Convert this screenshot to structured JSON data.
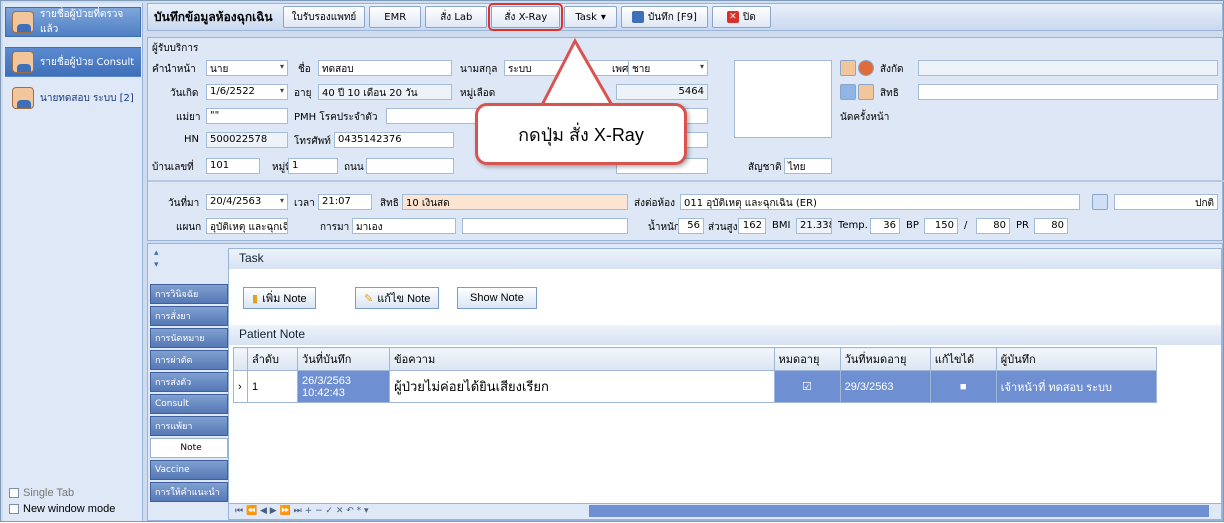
{
  "leftnav": {
    "items": [
      {
        "label": "รายชื่อผู้ป่วยที่ตรวจแล้ว"
      },
      {
        "label": "รายชื่อผู้ป่วย Consult"
      },
      {
        "label": "นายทดสอบ ระบบ [2]"
      }
    ],
    "single_tab": "Single Tab",
    "new_window": "New window mode"
  },
  "toolbar": {
    "title": "บันทึกข้อมูลห้องฉุกเฉิน",
    "btn_cert": "ใบรับรองแพทย์",
    "btn_emr": "EMR",
    "btn_lab": "สั่ง Lab",
    "btn_xray": "สั่ง X-Ray",
    "btn_task": "Task",
    "btn_save": "บันทึก [F9]",
    "btn_close": "ปิด"
  },
  "callout": {
    "text": "กดปุ่ม สั่ง X-Ray"
  },
  "form": {
    "section": "ผู้รับบริการ",
    "prefix_lbl": "คำนำหน้า",
    "prefix": "นาย",
    "name_lbl": "ชื่อ",
    "name": "ทดสอบ",
    "surname_lbl": "นามสกุล",
    "surname": "ระบบ",
    "sex_lbl": "เพศ",
    "sex": "ชาย",
    "affil_lbl": "สังกัด",
    "dob_lbl": "วันเกิด",
    "dob": "1/6/2522",
    "age_lbl": "อายุ",
    "age": "40 ปี 10 เดือน 20 วัน",
    "blood_lbl": "หมู่เลือด",
    "cid": "5464",
    "right_lbl": "สิทธิ",
    "mother_lbl": "แม่ยา",
    "mother": "\"\"",
    "pmh_lbl": "PMH โรคประจำตัว",
    "appt_lbl": "นัดครั้งหน้า",
    "hn_lbl": "HN",
    "hn": "500022578",
    "phone_lbl": "โทรศัพท์",
    "phone": "0435142376",
    "house_lbl": "บ้านเลขที่",
    "house": "101",
    "moo_lbl": "หมู่ที่",
    "moo": "1",
    "road_lbl": "ถนน",
    "nation_lbl": "สัญชาติ",
    "nation": "ไทย",
    "visit_lbl": "วันที่มา",
    "visit": "20/4/2563",
    "time_lbl": "เวลา",
    "time": "21:07",
    "right2_lbl": "สิทธิ",
    "right2": "10 เงินสด",
    "sendto_lbl": "ส่งต่อห้อง",
    "sendto": "011 อุบัติเหตุ และฉุกเฉิน (ER)",
    "status": "ปกติ",
    "dept_lbl": "แผนก",
    "dept": "อุบัติเหตุ และฉุกเฉิน (ER",
    "come_lbl": "การมา",
    "come": "มาเอง",
    "weight_lbl": "น้ำหนัก",
    "weight": "56",
    "height_lbl": "ส่วนสูง",
    "height": "162",
    "bmi_lbl": "BMI",
    "bmi": "21.338",
    "temp_lbl": "Temp.",
    "temp": "36",
    "bp_lbl": "BP",
    "bp_sys": "150",
    "bp_sep": "/",
    "bp_dia": "80",
    "pr_lbl": "PR",
    "pr": "80"
  },
  "sidetabs": [
    "การวินิจฉัย",
    "การสั่งยา",
    "การนัดหมาย",
    "การผ่าตัด",
    "การส่งตัว",
    "Consult",
    "การแพ้ยา",
    "Note",
    "Vaccine",
    "การให้คำแนะนำ"
  ],
  "task": {
    "header": "Task",
    "add_note": "เพิ่ม Note",
    "edit_note": "แก้ไข Note",
    "show_note": "Show Note"
  },
  "note": {
    "header": "Patient Note",
    "columns": [
      "ลำดับ",
      "วันที่บันทึก",
      "ข้อความ",
      "หมดอายุ",
      "วันที่หมดอายุ",
      "แก้ไขได้",
      "ผู้บันทึก"
    ],
    "row": {
      "idx": "1",
      "date": "26/3/2563",
      "time": "10:42:43",
      "msg": "ผู้ป่วยไม่ค่อยได้ยินเสียงเรียก",
      "expired": "☑",
      "exp_date": "29/3/2563",
      "editable": "■",
      "by": "เจ้าหน้าที่ ทดสอบ ระบบ"
    }
  }
}
